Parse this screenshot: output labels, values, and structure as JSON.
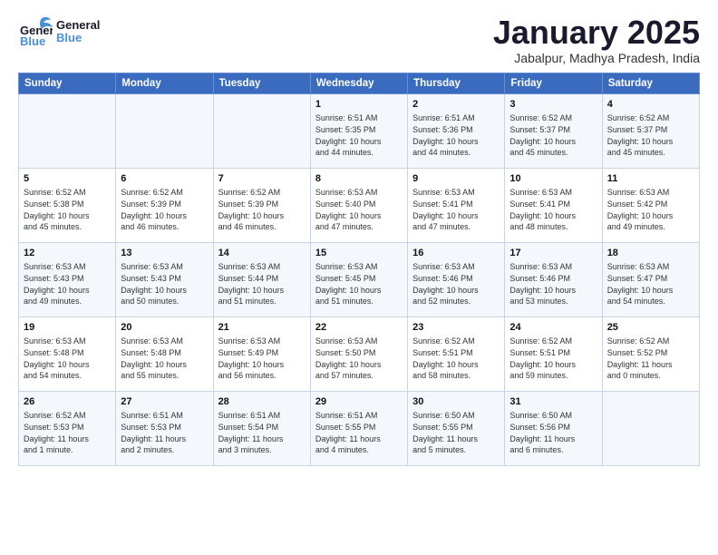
{
  "logo": {
    "line1": "General",
    "line2": "Blue"
  },
  "title": "January 2025",
  "subtitle": "Jabalpur, Madhya Pradesh, India",
  "days_of_week": [
    "Sunday",
    "Monday",
    "Tuesday",
    "Wednesday",
    "Thursday",
    "Friday",
    "Saturday"
  ],
  "weeks": [
    [
      {
        "day": "",
        "info": ""
      },
      {
        "day": "",
        "info": ""
      },
      {
        "day": "",
        "info": ""
      },
      {
        "day": "1",
        "info": "Sunrise: 6:51 AM\nSunset: 5:35 PM\nDaylight: 10 hours\nand 44 minutes."
      },
      {
        "day": "2",
        "info": "Sunrise: 6:51 AM\nSunset: 5:36 PM\nDaylight: 10 hours\nand 44 minutes."
      },
      {
        "day": "3",
        "info": "Sunrise: 6:52 AM\nSunset: 5:37 PM\nDaylight: 10 hours\nand 45 minutes."
      },
      {
        "day": "4",
        "info": "Sunrise: 6:52 AM\nSunset: 5:37 PM\nDaylight: 10 hours\nand 45 minutes."
      }
    ],
    [
      {
        "day": "5",
        "info": "Sunrise: 6:52 AM\nSunset: 5:38 PM\nDaylight: 10 hours\nand 45 minutes."
      },
      {
        "day": "6",
        "info": "Sunrise: 6:52 AM\nSunset: 5:39 PM\nDaylight: 10 hours\nand 46 minutes."
      },
      {
        "day": "7",
        "info": "Sunrise: 6:52 AM\nSunset: 5:39 PM\nDaylight: 10 hours\nand 46 minutes."
      },
      {
        "day": "8",
        "info": "Sunrise: 6:53 AM\nSunset: 5:40 PM\nDaylight: 10 hours\nand 47 minutes."
      },
      {
        "day": "9",
        "info": "Sunrise: 6:53 AM\nSunset: 5:41 PM\nDaylight: 10 hours\nand 47 minutes."
      },
      {
        "day": "10",
        "info": "Sunrise: 6:53 AM\nSunset: 5:41 PM\nDaylight: 10 hours\nand 48 minutes."
      },
      {
        "day": "11",
        "info": "Sunrise: 6:53 AM\nSunset: 5:42 PM\nDaylight: 10 hours\nand 49 minutes."
      }
    ],
    [
      {
        "day": "12",
        "info": "Sunrise: 6:53 AM\nSunset: 5:43 PM\nDaylight: 10 hours\nand 49 minutes."
      },
      {
        "day": "13",
        "info": "Sunrise: 6:53 AM\nSunset: 5:43 PM\nDaylight: 10 hours\nand 50 minutes."
      },
      {
        "day": "14",
        "info": "Sunrise: 6:53 AM\nSunset: 5:44 PM\nDaylight: 10 hours\nand 51 minutes."
      },
      {
        "day": "15",
        "info": "Sunrise: 6:53 AM\nSunset: 5:45 PM\nDaylight: 10 hours\nand 51 minutes."
      },
      {
        "day": "16",
        "info": "Sunrise: 6:53 AM\nSunset: 5:46 PM\nDaylight: 10 hours\nand 52 minutes."
      },
      {
        "day": "17",
        "info": "Sunrise: 6:53 AM\nSunset: 5:46 PM\nDaylight: 10 hours\nand 53 minutes."
      },
      {
        "day": "18",
        "info": "Sunrise: 6:53 AM\nSunset: 5:47 PM\nDaylight: 10 hours\nand 54 minutes."
      }
    ],
    [
      {
        "day": "19",
        "info": "Sunrise: 6:53 AM\nSunset: 5:48 PM\nDaylight: 10 hours\nand 54 minutes."
      },
      {
        "day": "20",
        "info": "Sunrise: 6:53 AM\nSunset: 5:48 PM\nDaylight: 10 hours\nand 55 minutes."
      },
      {
        "day": "21",
        "info": "Sunrise: 6:53 AM\nSunset: 5:49 PM\nDaylight: 10 hours\nand 56 minutes."
      },
      {
        "day": "22",
        "info": "Sunrise: 6:53 AM\nSunset: 5:50 PM\nDaylight: 10 hours\nand 57 minutes."
      },
      {
        "day": "23",
        "info": "Sunrise: 6:52 AM\nSunset: 5:51 PM\nDaylight: 10 hours\nand 58 minutes."
      },
      {
        "day": "24",
        "info": "Sunrise: 6:52 AM\nSunset: 5:51 PM\nDaylight: 10 hours\nand 59 minutes."
      },
      {
        "day": "25",
        "info": "Sunrise: 6:52 AM\nSunset: 5:52 PM\nDaylight: 11 hours\nand 0 minutes."
      }
    ],
    [
      {
        "day": "26",
        "info": "Sunrise: 6:52 AM\nSunset: 5:53 PM\nDaylight: 11 hours\nand 1 minute."
      },
      {
        "day": "27",
        "info": "Sunrise: 6:51 AM\nSunset: 5:53 PM\nDaylight: 11 hours\nand 2 minutes."
      },
      {
        "day": "28",
        "info": "Sunrise: 6:51 AM\nSunset: 5:54 PM\nDaylight: 11 hours\nand 3 minutes."
      },
      {
        "day": "29",
        "info": "Sunrise: 6:51 AM\nSunset: 5:55 PM\nDaylight: 11 hours\nand 4 minutes."
      },
      {
        "day": "30",
        "info": "Sunrise: 6:50 AM\nSunset: 5:55 PM\nDaylight: 11 hours\nand 5 minutes."
      },
      {
        "day": "31",
        "info": "Sunrise: 6:50 AM\nSunset: 5:56 PM\nDaylight: 11 hours\nand 6 minutes."
      },
      {
        "day": "",
        "info": ""
      }
    ]
  ]
}
